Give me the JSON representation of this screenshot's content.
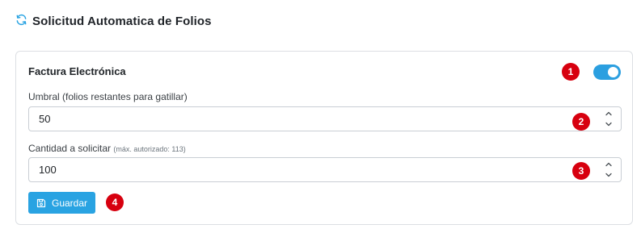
{
  "header": {
    "title": "Solicitud Automatica de Folios",
    "icon": "refresh-icon"
  },
  "card": {
    "title": "Factura Electrónica",
    "toggle": {
      "on": true,
      "color": "#2b9fe0"
    },
    "badges": [
      "1",
      "2",
      "3",
      "4"
    ],
    "threshold": {
      "label": "Umbral (folios restantes para gatillar)",
      "value": "50"
    },
    "quantity": {
      "label": "Cantidad a solicitar",
      "hint": "(máx. autorizado: 113)",
      "value": "100"
    },
    "save_button": {
      "label": "Guardar",
      "icon": "save-icon"
    }
  },
  "colors": {
    "accent": "#29a3e2",
    "badge": "#d7000f"
  }
}
